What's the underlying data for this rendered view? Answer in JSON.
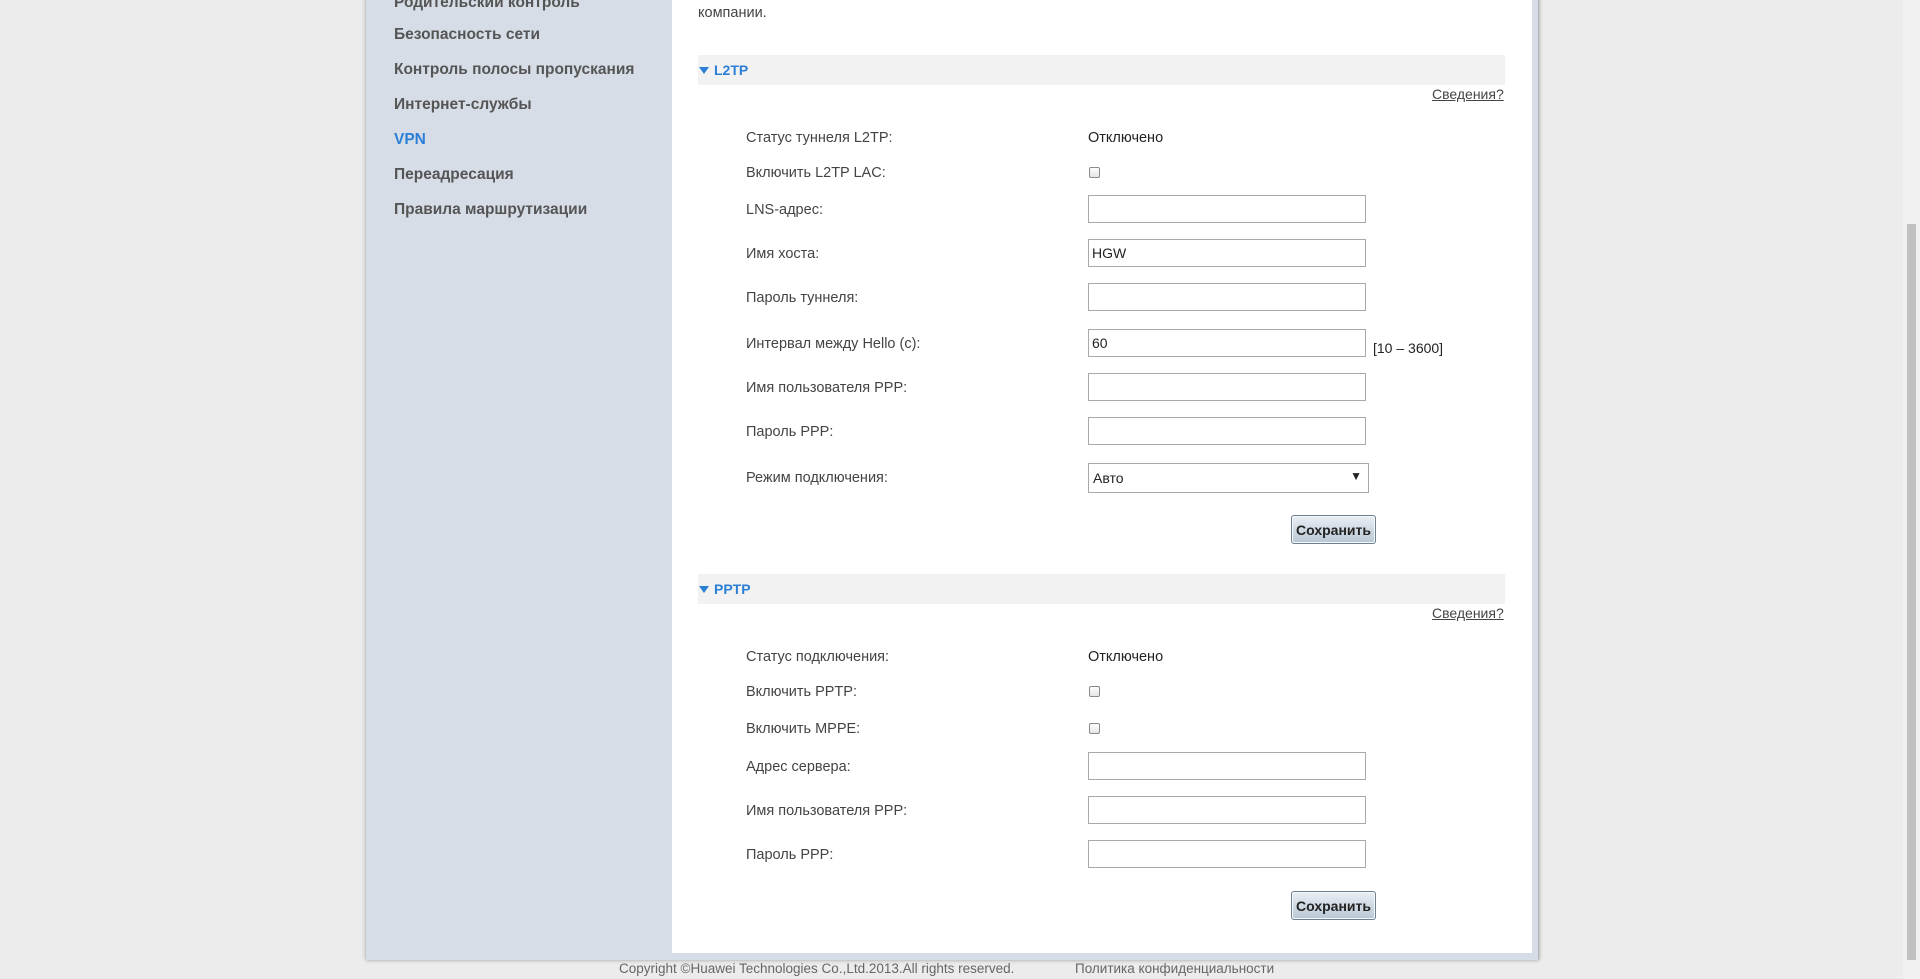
{
  "sidebar": {
    "items": [
      {
        "label": "Родительский контроль",
        "active": false
      },
      {
        "label": "Безопасность сети",
        "active": false
      },
      {
        "label": "Контроль полосы пропускания",
        "active": false
      },
      {
        "label": "Интернет-службы",
        "active": false
      },
      {
        "label": "VPN",
        "active": true
      },
      {
        "label": "Переадресация",
        "active": false
      },
      {
        "label": "Правила маршрутизации",
        "active": false
      }
    ]
  },
  "main": {
    "intro_text": "компании.",
    "l2tp": {
      "title": "L2TP",
      "help_link": "Сведения?",
      "status_label": "Статус туннеля L2TP:",
      "status_value": "Отключено",
      "enable_lac_label": "Включить L2TP LAC:",
      "enable_lac_checked": false,
      "lns_label": "LNS-адрес:",
      "lns_value": "",
      "hostname_label": "Имя хоста:",
      "hostname_value": "HGW",
      "tunnel_password_label": "Пароль туннеля:",
      "tunnel_password_value": "",
      "hello_interval_label": "Интервал между Hello (с):",
      "hello_interval_value": "60",
      "hello_interval_range": "[10 – 3600]",
      "ppp_user_label": "Имя пользователя PPP:",
      "ppp_user_value": "",
      "ppp_password_label": "Пароль PPP:",
      "ppp_password_value": "",
      "connection_mode_label": "Режим подключения:",
      "connection_mode_value": "Авто",
      "save_label": "Сохранить"
    },
    "pptp": {
      "title": "PPTP",
      "help_link": "Сведения?",
      "status_label": "Статус подключения:",
      "status_value": "Отключено",
      "enable_pptp_label": "Включить PPTP:",
      "enable_pptp_checked": false,
      "enable_mppe_label": "Включить MPPE:",
      "enable_mppe_checked": false,
      "server_label": "Адрес сервера:",
      "server_value": "",
      "ppp_user_label": "Имя пользователя PPP:",
      "ppp_user_value": "",
      "ppp_password_label": "Пароль PPP:",
      "ppp_password_value": "",
      "save_label": "Сохранить"
    }
  },
  "footer": {
    "copyright": "Copyright ©Huawei Technologies Co.,Ltd.2013.All rights reserved.",
    "privacy_link": "Политика конфиденциальности"
  },
  "colors": {
    "accent": "#2c7fd6",
    "sidebar_bg": "#d6dde6",
    "page_bg": "#ececec"
  }
}
